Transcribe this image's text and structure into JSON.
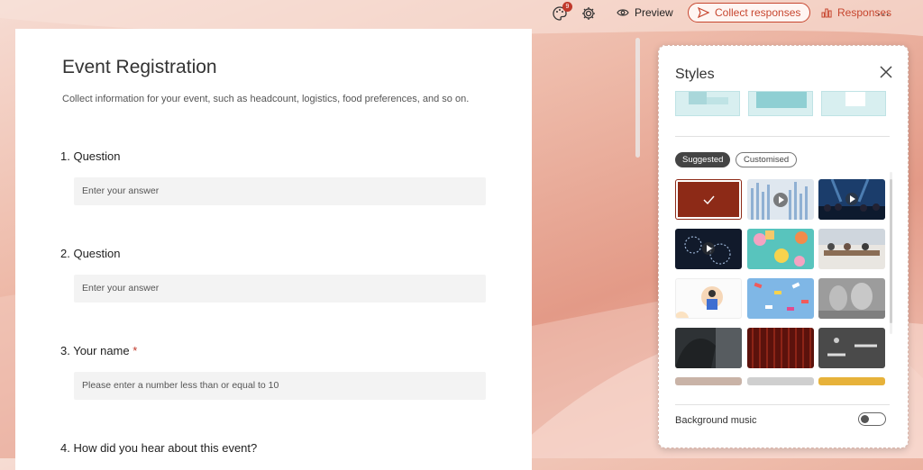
{
  "toolbar": {
    "notification_count": "9",
    "preview_label": "Preview",
    "collect_label": "Collect responses",
    "responses_label": "Responses",
    "more_label": "..."
  },
  "form": {
    "title": "Event Registration",
    "description": "Collect information for your event, such as headcount, logistics, food preferences, and so on.",
    "questions": [
      {
        "label": "1. Question",
        "placeholder": "Enter your answer",
        "required": false
      },
      {
        "label": "2. Question",
        "placeholder": "Enter your answer",
        "required": false
      },
      {
        "label": "3. Your name",
        "placeholder": "Please enter a number less than or equal to 10",
        "required": true,
        "required_mark": "*"
      },
      {
        "label": "4. How did you hear about this event?",
        "required": false
      }
    ]
  },
  "styles_panel": {
    "title": "Styles",
    "tabs": [
      {
        "label": "Suggested",
        "active": true
      },
      {
        "label": "Customised",
        "active": false
      }
    ],
    "selected_theme_index": 0,
    "themes": [
      {
        "name": "dark-red-solid",
        "icon": "checkmark-icon"
      },
      {
        "name": "blue-bars-video",
        "icon": "play-icon"
      },
      {
        "name": "concert-crowd-video",
        "icon": "play-icon"
      },
      {
        "name": "dark-floral-video",
        "icon": "play-icon"
      },
      {
        "name": "colorful-donuts"
      },
      {
        "name": "office-meeting"
      },
      {
        "name": "person-illustration"
      },
      {
        "name": "colorful-confetti"
      },
      {
        "name": "glassware-grey"
      },
      {
        "name": "car-interior"
      },
      {
        "name": "red-curtain"
      },
      {
        "name": "road-marking"
      }
    ],
    "music_label": "Background music",
    "music_on": false
  },
  "colors": {
    "accent": "#c7462f",
    "selected_theme": "#8d2a17"
  }
}
